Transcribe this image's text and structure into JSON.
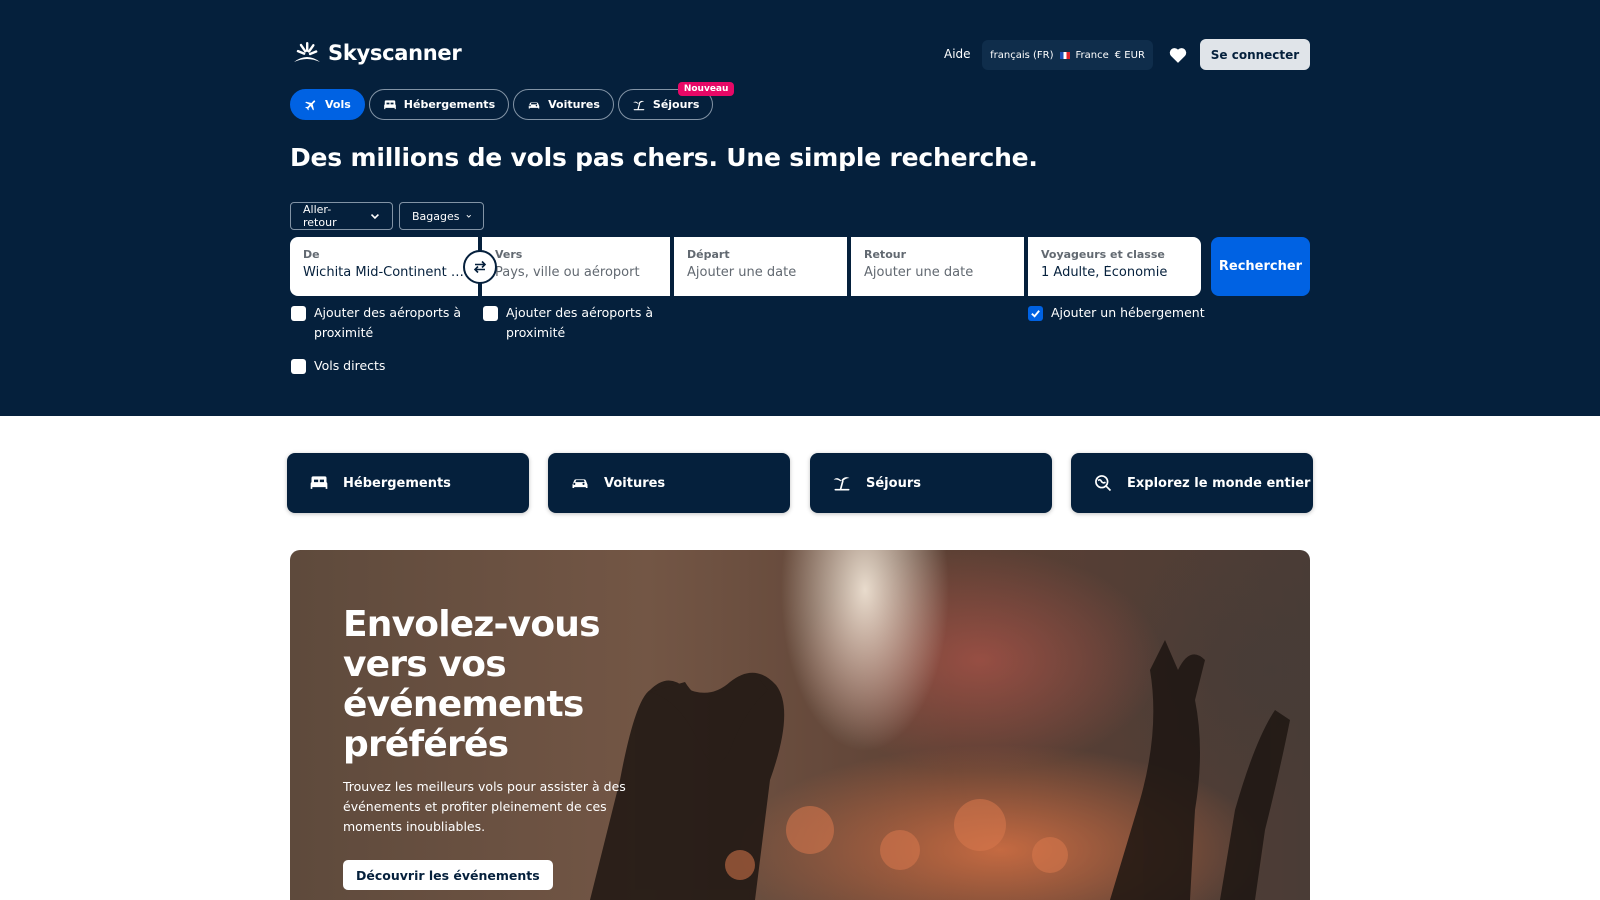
{
  "header": {
    "brand": "Skyscanner",
    "help": "Aide",
    "locale": {
      "language": "français (FR)",
      "country": "France",
      "currency": "€ EUR"
    },
    "favorites_icon": "heart-icon",
    "login": "Se connecter"
  },
  "tabs": [
    {
      "label": "Vols",
      "icon": "plane-icon",
      "active": true
    },
    {
      "label": "Hébergements",
      "icon": "bed-icon"
    },
    {
      "label": "Voitures",
      "icon": "car-icon"
    },
    {
      "label": "Séjours",
      "icon": "beach-icon",
      "badge": "Nouveau"
    }
  ],
  "headline": "Des millions de vols pas chers. Une simple recherche.",
  "filters": {
    "trip_type": "Aller-retour",
    "baggage": "Bagages"
  },
  "search": {
    "from": {
      "label": "De",
      "value": "Wichita Mid-Continent (I..."
    },
    "to": {
      "label": "Vers",
      "placeholder": "Pays, ville ou aéroport"
    },
    "depart": {
      "label": "Départ",
      "placeholder": "Ajouter une date"
    },
    "return": {
      "label": "Retour",
      "placeholder": "Ajouter une date"
    },
    "travellers": {
      "label": "Voyageurs et classe",
      "value": "1 Adulte, Économie"
    },
    "submit": "Rechercher"
  },
  "options": {
    "nearby_from": {
      "label": "Ajouter des aéroports à proximité",
      "checked": false
    },
    "nearby_to": {
      "label": "Ajouter des aéroports à proximité",
      "checked": false
    },
    "direct": {
      "label": "Vols directs",
      "checked": false
    },
    "hotel": {
      "label": "Ajouter un hébergement",
      "checked": true
    }
  },
  "quick_links": [
    {
      "label": "Hébergements",
      "icon": "bed-icon"
    },
    {
      "label": "Voitures",
      "icon": "car-icon"
    },
    {
      "label": "Séjours",
      "icon": "beach-icon"
    },
    {
      "label": "Explorez le monde entier",
      "icon": "globe-search-icon"
    }
  ],
  "banner": {
    "title": "Envolez-vous vers vos événements préférés",
    "description": "Trouvez les meilleurs vols pour assister à des événements et profiter pleinement de ces moments inoubliables.",
    "cta": "Découvrir les événements"
  },
  "colors": {
    "navy": "#05203c",
    "primary_blue": "#0062e3",
    "badge_pink": "#e70866"
  }
}
